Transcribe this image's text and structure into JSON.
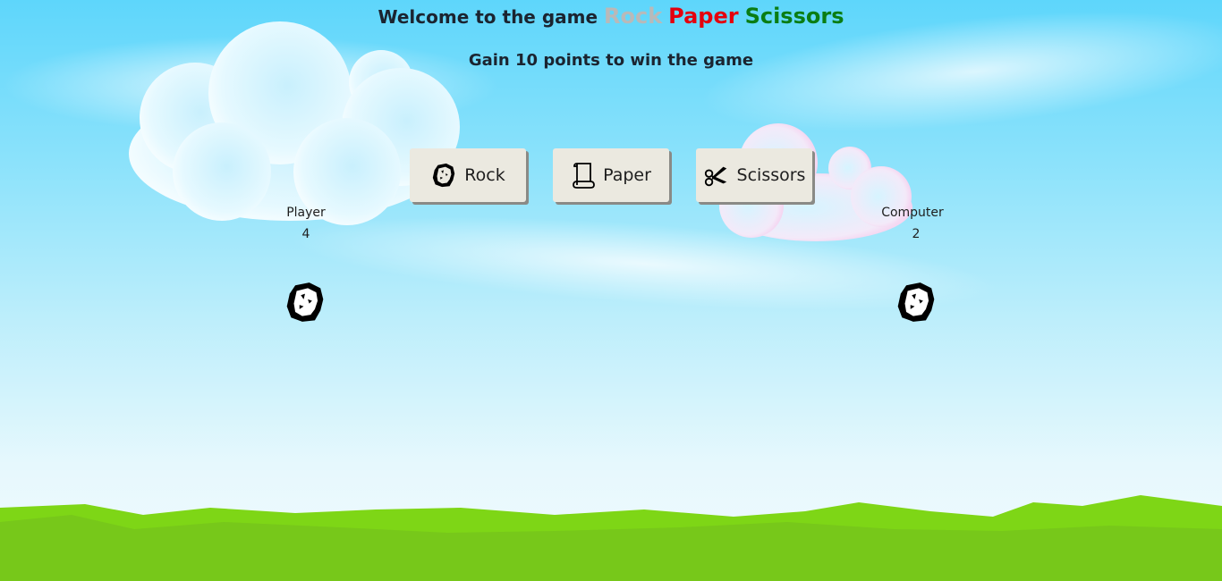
{
  "header": {
    "welcome_text": "Welcome to the game",
    "rock_word": "Rock",
    "paper_word": "Paper",
    "scissors_word": "Scissors",
    "subtitle": "Gain 10 points to win the game"
  },
  "colors": {
    "rock": "#b9b9b9",
    "paper": "#e5000d",
    "scissors": "#0a7d14",
    "grass": "#7ed616"
  },
  "choices": [
    {
      "label": "Rock",
      "icon": "rock-icon"
    },
    {
      "label": "Paper",
      "icon": "scroll-icon"
    },
    {
      "label": "Scissors",
      "icon": "scissors-icon"
    }
  ],
  "player": {
    "label": "Player",
    "score": "4",
    "choice_icon": "rock-icon"
  },
  "computer": {
    "label": "Computer",
    "score": "2",
    "choice_icon": "rock-icon"
  }
}
